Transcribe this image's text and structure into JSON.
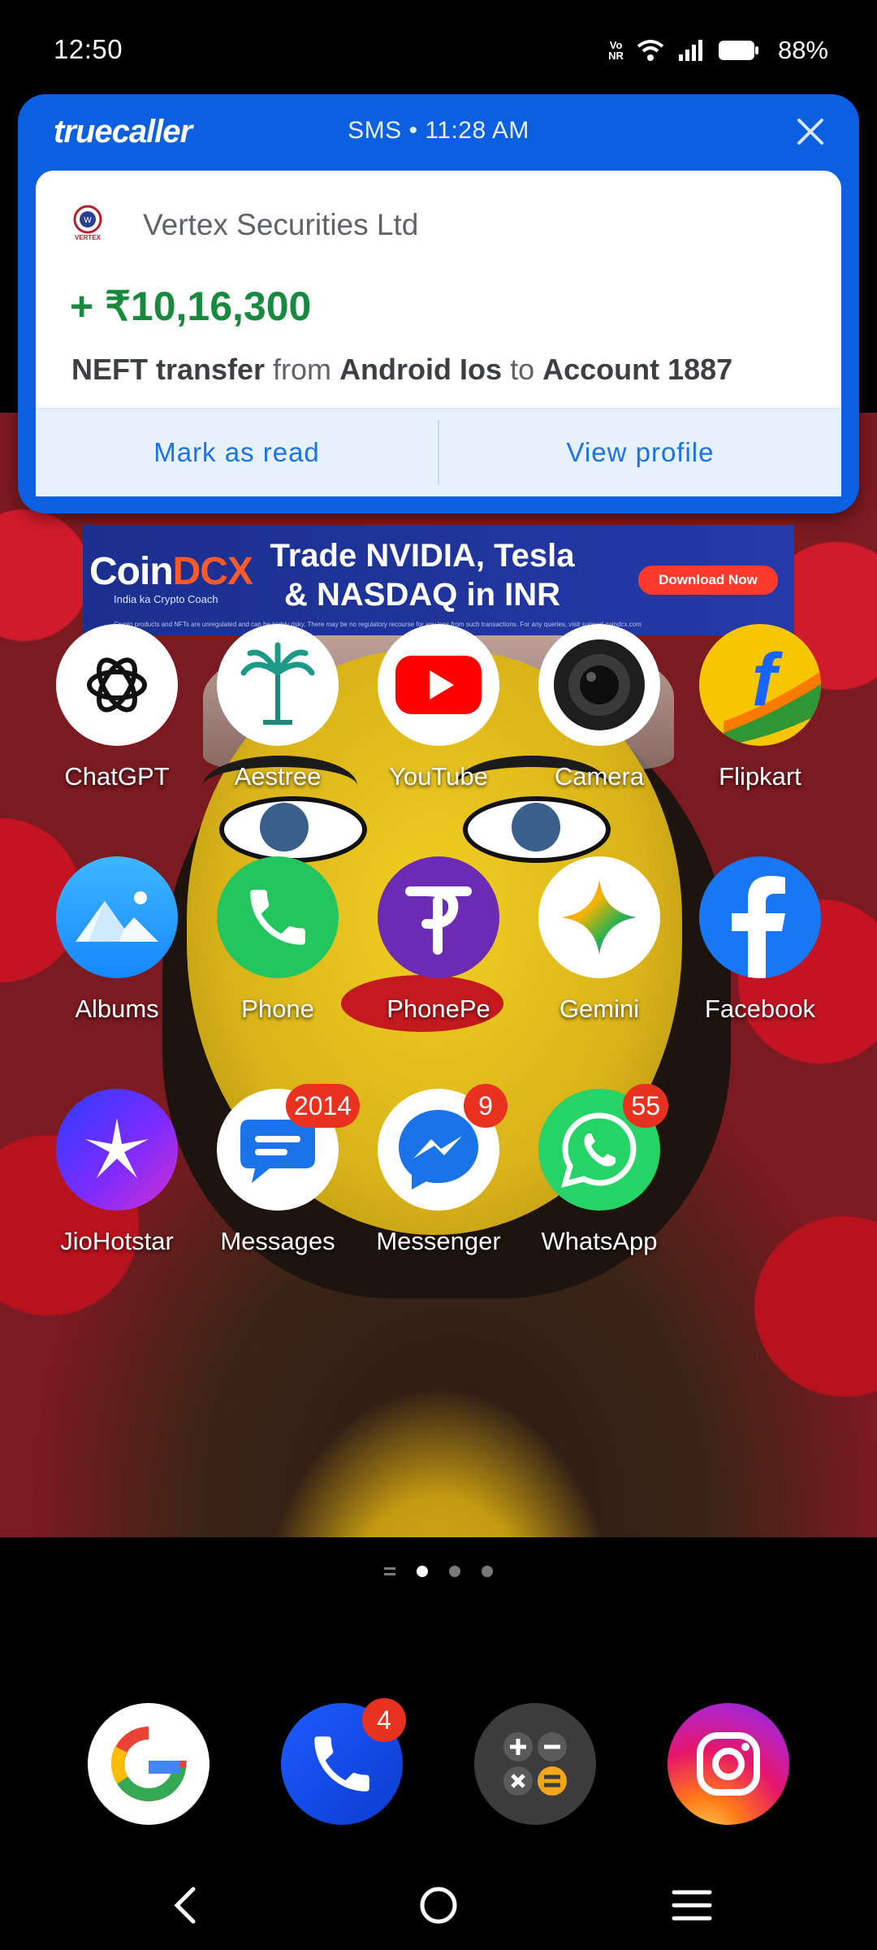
{
  "status_bar": {
    "time": "12:50",
    "battery_percent": "88%",
    "network_tag_top": "Vo",
    "network_tag_bottom": "NR"
  },
  "notification": {
    "app": "truecaller",
    "meta": "SMS • 11:28 AM",
    "sender": "Vertex Securities Ltd",
    "sender_logo_text": "VERTEX",
    "amount": "+ ₹10,16,300",
    "detail": {
      "part1": "NEFT transfer",
      "part2": " from ",
      "part3": "Android Ios",
      "part4": " to ",
      "part5": "Account 1887"
    },
    "actions": {
      "mark_read": "Mark as read",
      "view_profile": "View profile"
    }
  },
  "ad": {
    "brand_main": "Coin",
    "brand_accent": "DCX",
    "brand_tagline": "India ka Crypto Coach",
    "headline_line1": "Trade NVIDIA, Tesla",
    "headline_line2": "& NASDAQ in INR",
    "cta": "Download Now",
    "disclaimer": "Crypto products and NFTs are unregulated and can be highly risky. There may be no regulatory recourse for any loss from such transactions. For any queries, visit support.coindcx.com"
  },
  "apps": [
    {
      "label": "ChatGPT",
      "icon": "chatgpt-icon"
    },
    {
      "label": "Aestree",
      "icon": "palm-tree-icon"
    },
    {
      "label": "YouTube",
      "icon": "youtube-icon"
    },
    {
      "label": "Camera",
      "icon": "camera-icon"
    },
    {
      "label": "Flipkart",
      "icon": "flipkart-icon"
    },
    {
      "label": "Albums",
      "icon": "albums-icon"
    },
    {
      "label": "Phone",
      "icon": "phone-icon"
    },
    {
      "label": "PhonePe",
      "icon": "phonepe-icon"
    },
    {
      "label": "Gemini",
      "icon": "gemini-icon"
    },
    {
      "label": "Facebook",
      "icon": "facebook-icon"
    },
    {
      "label": "JioHotstar",
      "icon": "jiohotstar-icon"
    },
    {
      "label": "Messages",
      "icon": "messages-icon",
      "badge": "2014"
    },
    {
      "label": "Messenger",
      "icon": "messenger-icon",
      "badge": "9"
    },
    {
      "label": "WhatsApp",
      "icon": "whatsapp-icon",
      "badge": "55"
    }
  ],
  "dock": [
    {
      "icon": "google-icon"
    },
    {
      "icon": "truecaller-dialer-icon",
      "badge": "4"
    },
    {
      "icon": "calculator-icon"
    },
    {
      "icon": "instagram-icon"
    }
  ],
  "pager": {
    "pages": 3,
    "active": 1
  },
  "colors": {
    "truecaller_blue": "#0b5fe0",
    "amount_green": "#18893d",
    "badge_red": "#e8321f",
    "link_blue": "#1a73e8"
  }
}
